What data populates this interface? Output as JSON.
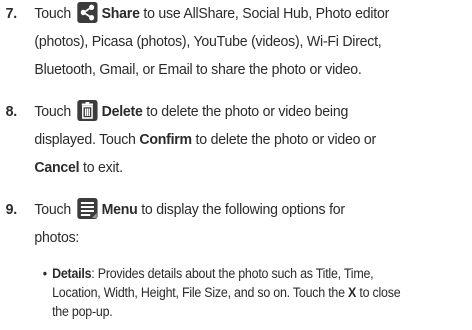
{
  "steps": [
    {
      "number": "7.",
      "icon": "share-icon",
      "lines": [
        {
          "pre": "Touch ",
          "bold": "Share",
          "post": " to use AllShare, Social Hub, Photo editor"
        },
        {
          "text": "(photos), Picasa (photos), YouTube (videos), Wi-Fi Direct,"
        },
        {
          "text": "Bluetooth, Gmail, or Email to share the photo or video."
        }
      ]
    },
    {
      "number": "8.",
      "icon": "delete-icon",
      "lines": [
        {
          "pre": "Touch ",
          "bold": "Delete",
          "post": " to delete the photo or video being"
        },
        {
          "text": "displayed. Touch "
        },
        {
          "bold": "Confirm",
          "post": " to delete the photo or video or"
        },
        {
          "bold": "Cancel",
          "post": " to exit."
        }
      ]
    },
    {
      "number": "9.",
      "icon": "menu-icon",
      "lines": [
        {
          "pre": "Touch ",
          "bold": "Menu",
          "post": " to display the following options for"
        },
        {
          "text": "photos:"
        }
      ]
    }
  ],
  "bullets": [
    {
      "bold": "Details",
      "lines": [
        ": Provides details about the photo such as Title, Time,",
        "Location, Width, Height, File Size, and so on. Touch the ",
        "X",
        " to close",
        "the pop-up."
      ]
    }
  ],
  "colors": {
    "text": "#2b2b2b",
    "icon_bg": "#3c3c3c",
    "icon_fg": "#ffffff"
  }
}
